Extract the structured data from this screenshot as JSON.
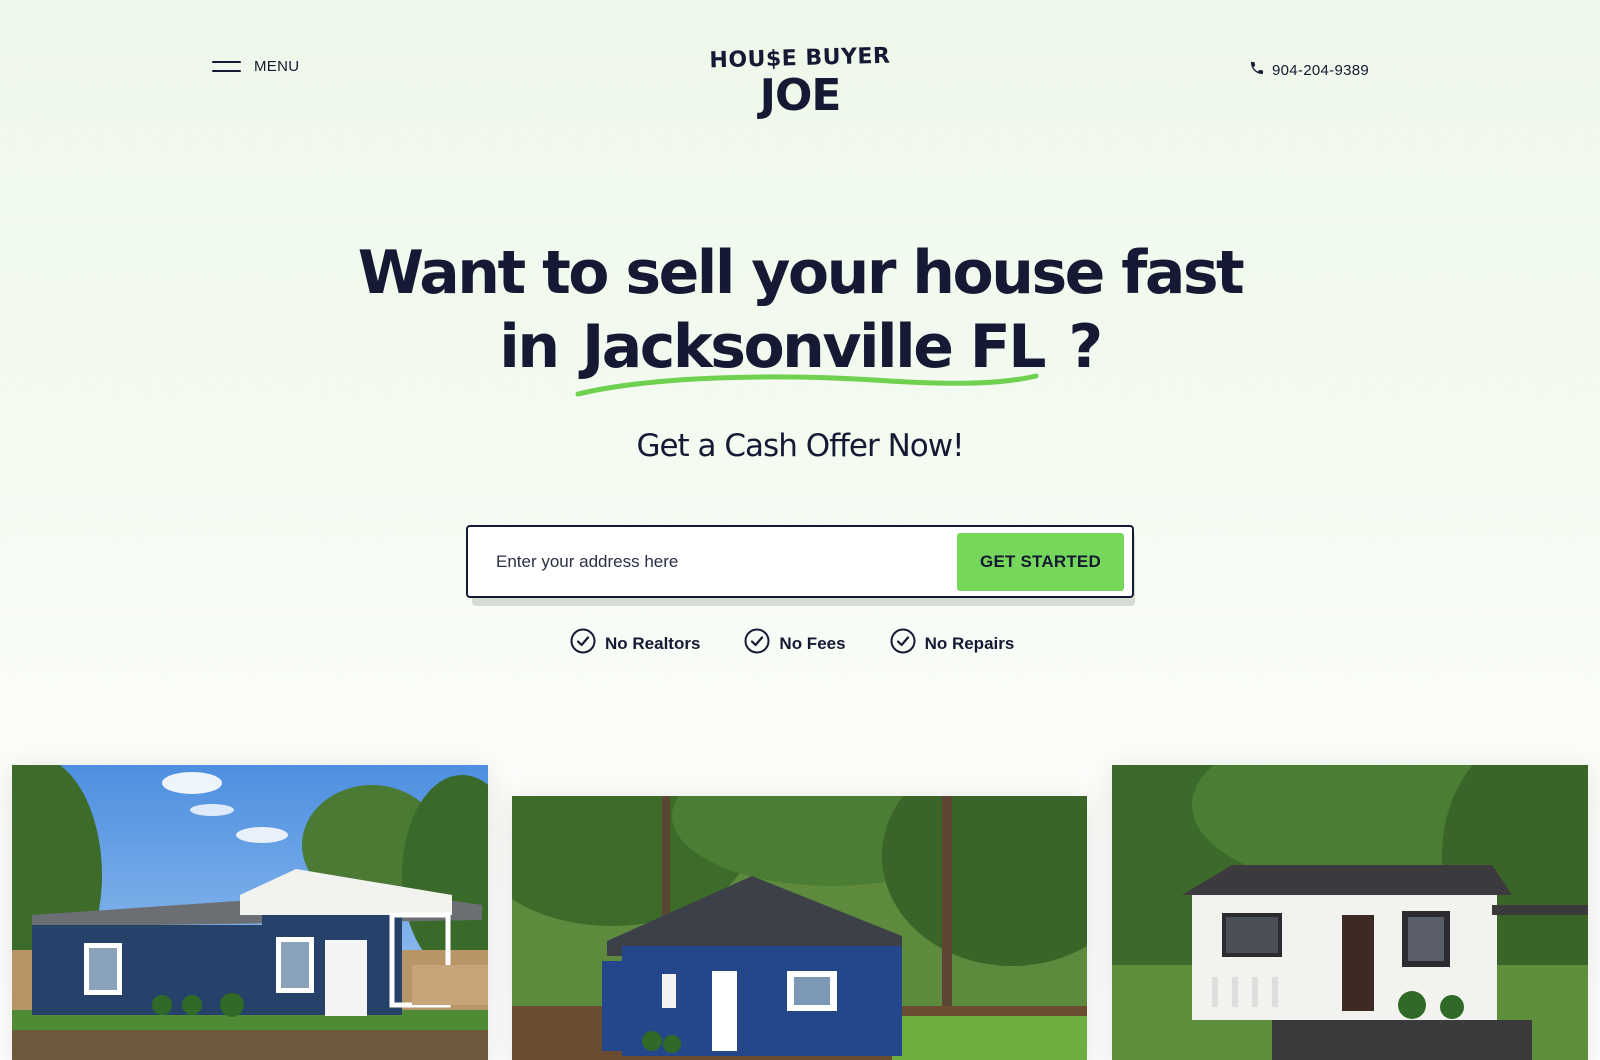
{
  "header": {
    "menu_label": "MENU",
    "logo_top": "HOU$E BUYER",
    "logo_main": "JOE",
    "phone": "904-204-9389"
  },
  "hero": {
    "title_line1": "Want to sell your house fast",
    "title_line2_prefix": "in",
    "city": "Jacksonville FL",
    "title_line2_suffix": "?",
    "subtitle": "Get a Cash Offer Now!"
  },
  "form": {
    "address_placeholder": "Enter your address here",
    "cta_label": "GET STARTED"
  },
  "benefits": [
    {
      "label": "No Realtors"
    },
    {
      "label": "No Fees"
    },
    {
      "label": "No Repairs"
    }
  ],
  "colors": {
    "brand_dark": "#141a33",
    "accent_green": "#76d85b",
    "underline_green": "#6fd14f"
  },
  "photos": [
    {
      "icon": "house-photo",
      "house_color": "navy",
      "description_visible": false
    },
    {
      "icon": "house-photo",
      "house_color": "blue",
      "description_visible": false
    },
    {
      "icon": "house-photo",
      "house_color": "white",
      "description_visible": false
    }
  ]
}
